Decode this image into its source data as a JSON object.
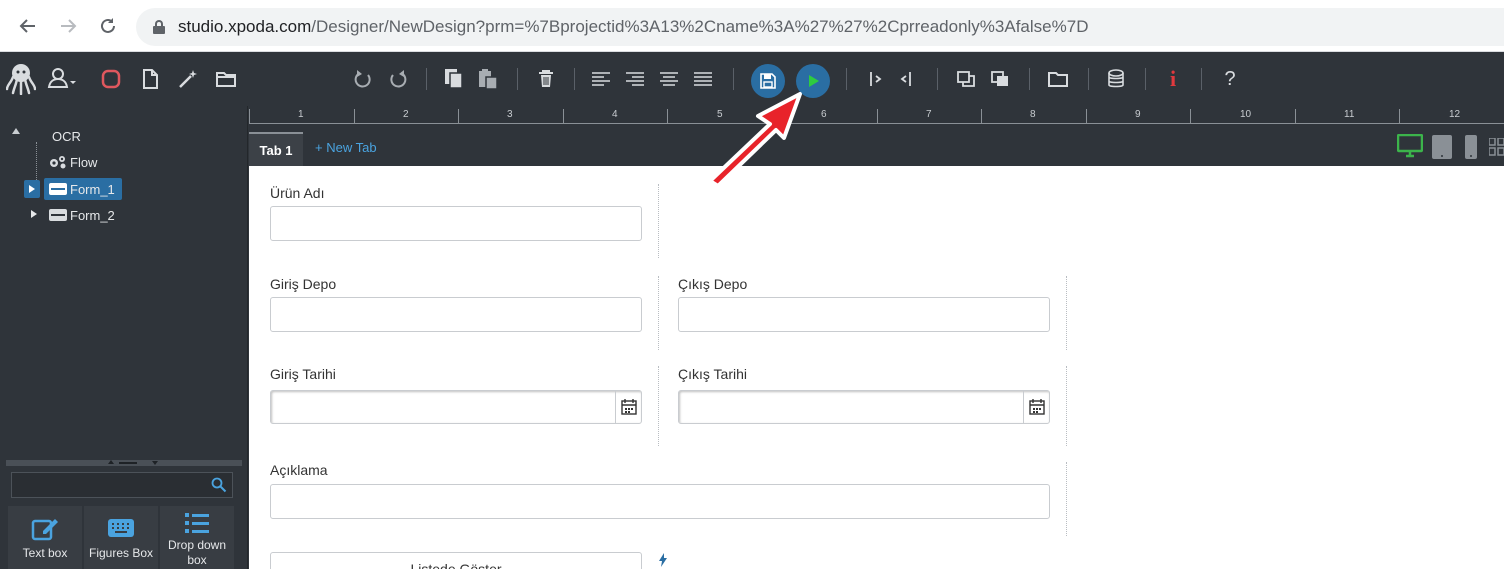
{
  "browser": {
    "url_host": "studio.xpoda.com",
    "url_path": "/Designer/NewDesign?prm=%7Bprojectid%3A13%2Cname%3A%27%27%2Cprreadonly%3Afalse%7D"
  },
  "toolbar": {
    "icons": [
      "octopus-logo",
      "user-icon",
      "stop-icon",
      "new-page-icon",
      "magic-wand-icon",
      "folder-icon",
      "undo-icon",
      "redo-icon",
      "copy-icon",
      "paste-icon",
      "delete-icon",
      "align-left-icon",
      "align-right-icon",
      "align-center-icon",
      "align-justify-icon",
      "save-icon",
      "run-icon",
      "indent-icon",
      "outdent-icon",
      "bring-front-icon",
      "send-back-icon",
      "open-folder-icon",
      "database-icon",
      "info-icon",
      "help-icon"
    ],
    "save_color": "#2a6ea3",
    "run_color": "#2a6ea3",
    "run_arrow_color": "#2ecc40",
    "info_label": "i",
    "help_label": "?"
  },
  "tree": {
    "root": "OCR",
    "items": [
      {
        "label": "Flow",
        "icon": "gears-icon"
      },
      {
        "label": "Form_1",
        "icon": "form-icon",
        "selected": true
      },
      {
        "label": "Form_2",
        "icon": "form-icon"
      }
    ]
  },
  "components": [
    {
      "label": "Text box",
      "icon": "edit-icon"
    },
    {
      "label": "Figures Box",
      "icon": "keyboard-icon"
    },
    {
      "label": "Drop down box",
      "icon": "list-icon"
    }
  ],
  "ruler": {
    "labels": [
      "1",
      "2",
      "3",
      "4",
      "5",
      "6",
      "7",
      "8",
      "9",
      "10",
      "11",
      "12"
    ]
  },
  "tabs": {
    "active": "Tab 1",
    "new_tab": "+ New Tab"
  },
  "devices": [
    "desktop-icon",
    "tablet-icon",
    "phone-icon",
    "grid-icon"
  ],
  "form": {
    "urun_adi": "Ürün Adı",
    "giris_depo": "Giriş Depo",
    "cikis_depo": "Çıkış Depo",
    "giris_tarihi": "Giriş Tarihi",
    "cikis_tarihi": "Çıkış Tarihi",
    "aciklama": "Açıklama",
    "button": "Listede Göster"
  },
  "annotation": {
    "arrow_color": "#e8232a"
  }
}
